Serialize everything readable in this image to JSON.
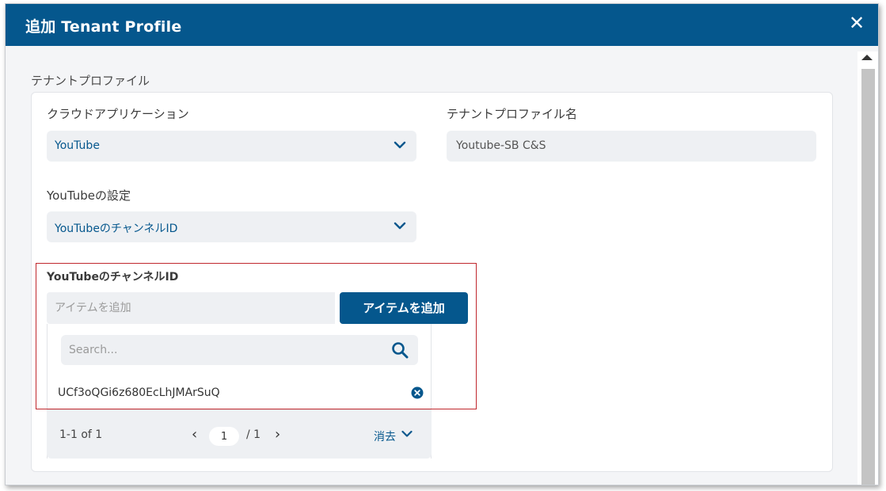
{
  "dialog": {
    "title": "追加 Tenant Profile",
    "close_glyph": "✕",
    "section_title": "テナントプロファイル"
  },
  "form": {
    "cloud_app": {
      "label": "クラウドアプリケーション",
      "value": "YouTube"
    },
    "tenant_profile_name": {
      "label": "テナントプロファイル名",
      "value": "Youtube-SB C&S"
    },
    "youtube_settings": {
      "label": "YouTubeの設定",
      "value": "YouTubeのチャンネルID"
    },
    "channel_id": {
      "label": "YouTubeのチャンネルID",
      "input_placeholder": "アイテムを追加",
      "add_button": "アイテムを追加",
      "search_placeholder": "Search...",
      "items": [
        "UCf3oQGi6z680EcLhJMArSuQ"
      ],
      "pagination": {
        "range": "1-1 of 1",
        "prev": "‹",
        "current_page": "1",
        "total": "/ 1",
        "next": "›",
        "clear_label": "消去"
      }
    }
  },
  "colors": {
    "header": "#05578d",
    "accent": "#05578d",
    "highlight_border": "#c0272d",
    "field_bg": "#eef0f3"
  },
  "icons": {
    "close": "close-icon",
    "dropdown": "chevron-down-icon",
    "search": "search-icon",
    "remove": "remove-circle-icon"
  }
}
